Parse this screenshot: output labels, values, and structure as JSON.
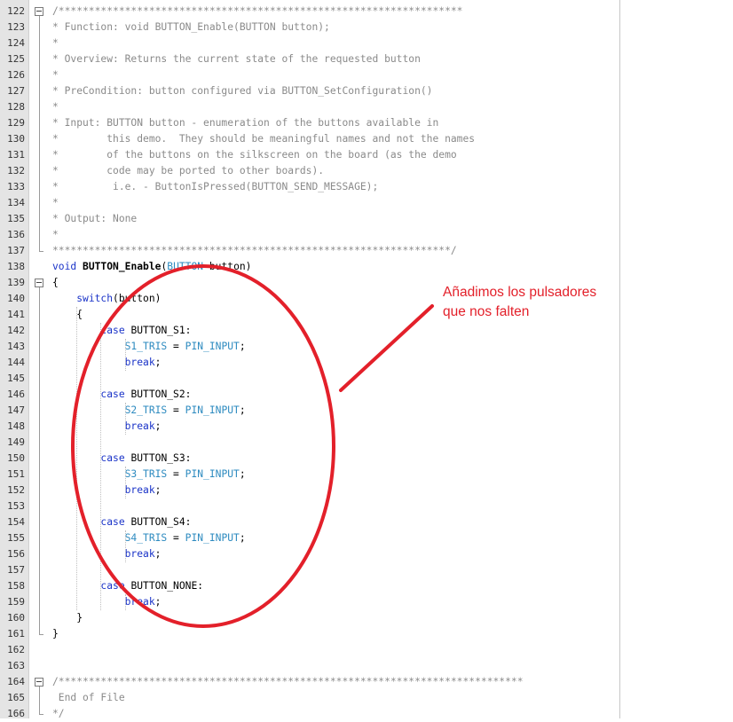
{
  "editor": {
    "lines": [
      {
        "n": "122",
        "fold": "box",
        "segs": [
          [
            "/*******************************************************************",
            "c-comment"
          ]
        ]
      },
      {
        "n": "123",
        "segs": [
          [
            "* Function: void BUTTON_Enable(BUTTON button);",
            "c-comment"
          ]
        ]
      },
      {
        "n": "124",
        "segs": [
          [
            "*",
            "c-comment"
          ]
        ]
      },
      {
        "n": "125",
        "segs": [
          [
            "* Overview: Returns the current state of the requested button",
            "c-comment"
          ]
        ]
      },
      {
        "n": "126",
        "segs": [
          [
            "*",
            "c-comment"
          ]
        ]
      },
      {
        "n": "127",
        "segs": [
          [
            "* PreCondition: button configured via BUTTON_SetConfiguration()",
            "c-comment"
          ]
        ]
      },
      {
        "n": "128",
        "segs": [
          [
            "*",
            "c-comment"
          ]
        ]
      },
      {
        "n": "129",
        "segs": [
          [
            "* Input: BUTTON button - enumeration of the buttons available in",
            "c-comment"
          ]
        ]
      },
      {
        "n": "130",
        "segs": [
          [
            "*        this demo.  They should be meaningful names and not the names",
            "c-comment"
          ]
        ]
      },
      {
        "n": "131",
        "segs": [
          [
            "*        of the buttons on the silkscreen on the board (as the demo",
            "c-comment"
          ]
        ]
      },
      {
        "n": "132",
        "segs": [
          [
            "*        code may be ported to other boards).",
            "c-comment"
          ]
        ]
      },
      {
        "n": "133",
        "segs": [
          [
            "*         i.e. - ButtonIsPressed(BUTTON_SEND_MESSAGE);",
            "c-comment"
          ]
        ]
      },
      {
        "n": "134",
        "segs": [
          [
            "*",
            "c-comment"
          ]
        ]
      },
      {
        "n": "135",
        "segs": [
          [
            "* Output: None",
            "c-comment"
          ]
        ]
      },
      {
        "n": "136",
        "segs": [
          [
            "*",
            "c-comment"
          ]
        ]
      },
      {
        "n": "137",
        "fold": "end",
        "segs": [
          [
            "******************************************************************/",
            "c-comment"
          ]
        ]
      },
      {
        "n": "138",
        "segs": [
          [
            "void",
            "c-keyword"
          ],
          [
            " ",
            ""
          ],
          [
            "BUTTON_Enable",
            "c-bold"
          ],
          [
            "(",
            ""
          ],
          [
            "BUTTON",
            "c-ident"
          ],
          [
            " button)",
            ""
          ]
        ]
      },
      {
        "n": "139",
        "fold": "box",
        "segs": [
          [
            "{",
            ""
          ]
        ]
      },
      {
        "n": "140",
        "segs": [
          [
            "    ",
            ""
          ],
          [
            "switch",
            "c-keyword"
          ],
          [
            "(button)",
            ""
          ]
        ]
      },
      {
        "n": "141",
        "segs": [
          [
            "    {",
            ""
          ]
        ]
      },
      {
        "n": "142",
        "segs": [
          [
            "        ",
            ""
          ],
          [
            "case",
            "c-keyword"
          ],
          [
            " BUTTON_S1:",
            ""
          ]
        ]
      },
      {
        "n": "143",
        "segs": [
          [
            "            ",
            ""
          ],
          [
            "S1_TRIS",
            "c-ident"
          ],
          [
            " = ",
            ""
          ],
          [
            "PIN_INPUT",
            "c-ident"
          ],
          [
            ";",
            ""
          ]
        ]
      },
      {
        "n": "144",
        "segs": [
          [
            "            ",
            ""
          ],
          [
            "break",
            "c-keyword"
          ],
          [
            ";",
            ""
          ]
        ]
      },
      {
        "n": "145",
        "segs": []
      },
      {
        "n": "146",
        "segs": [
          [
            "        ",
            ""
          ],
          [
            "case",
            "c-keyword"
          ],
          [
            " BUTTON_S2:",
            ""
          ]
        ]
      },
      {
        "n": "147",
        "segs": [
          [
            "            ",
            ""
          ],
          [
            "S2_TRIS",
            "c-ident"
          ],
          [
            " = ",
            ""
          ],
          [
            "PIN_INPUT",
            "c-ident"
          ],
          [
            ";",
            ""
          ]
        ]
      },
      {
        "n": "148",
        "segs": [
          [
            "            ",
            ""
          ],
          [
            "break",
            "c-keyword"
          ],
          [
            ";",
            ""
          ]
        ]
      },
      {
        "n": "149",
        "segs": []
      },
      {
        "n": "150",
        "segs": [
          [
            "        ",
            ""
          ],
          [
            "case",
            "c-keyword"
          ],
          [
            " BUTTON_S3:",
            ""
          ]
        ]
      },
      {
        "n": "151",
        "segs": [
          [
            "            ",
            ""
          ],
          [
            "S3_TRIS",
            "c-ident"
          ],
          [
            " = ",
            ""
          ],
          [
            "PIN_INPUT",
            "c-ident"
          ],
          [
            ";",
            ""
          ]
        ]
      },
      {
        "n": "152",
        "segs": [
          [
            "            ",
            ""
          ],
          [
            "break",
            "c-keyword"
          ],
          [
            ";",
            ""
          ]
        ]
      },
      {
        "n": "153",
        "segs": []
      },
      {
        "n": "154",
        "segs": [
          [
            "        ",
            ""
          ],
          [
            "case",
            "c-keyword"
          ],
          [
            " BUTTON_S4:",
            ""
          ]
        ]
      },
      {
        "n": "155",
        "segs": [
          [
            "            ",
            ""
          ],
          [
            "S4_TRIS",
            "c-ident"
          ],
          [
            " = ",
            ""
          ],
          [
            "PIN_INPUT",
            "c-ident"
          ],
          [
            ";",
            ""
          ]
        ]
      },
      {
        "n": "156",
        "segs": [
          [
            "            ",
            ""
          ],
          [
            "break",
            "c-keyword"
          ],
          [
            ";",
            ""
          ]
        ]
      },
      {
        "n": "157",
        "segs": []
      },
      {
        "n": "158",
        "segs": [
          [
            "        ",
            ""
          ],
          [
            "case",
            "c-keyword"
          ],
          [
            " BUTTON_NONE:",
            ""
          ]
        ]
      },
      {
        "n": "159",
        "segs": [
          [
            "            ",
            ""
          ],
          [
            "break",
            "c-keyword"
          ],
          [
            ";",
            ""
          ]
        ]
      },
      {
        "n": "160",
        "segs": [
          [
            "    }",
            ""
          ]
        ]
      },
      {
        "n": "161",
        "fold": "end",
        "segs": [
          [
            "}",
            ""
          ]
        ]
      },
      {
        "n": "162",
        "segs": []
      },
      {
        "n": "163",
        "segs": []
      },
      {
        "n": "164",
        "fold": "box",
        "segs": [
          [
            "/*****************************************************************************",
            "c-comment"
          ]
        ]
      },
      {
        "n": "165",
        "segs": [
          [
            " End of File",
            "c-comment"
          ]
        ]
      },
      {
        "n": "166",
        "fold": "end",
        "segs": [
          [
            "*/",
            "c-comment"
          ]
        ]
      }
    ]
  },
  "annotation": {
    "text_line1": "Añadimos los pulsadores",
    "text_line2": "que nos falten",
    "color": "#e3202a"
  },
  "colors": {
    "comment": "#8a8a8a",
    "keyword": "#1a33c8",
    "identifier": "#2e8bc0",
    "gutter": "#e4e4e4"
  }
}
